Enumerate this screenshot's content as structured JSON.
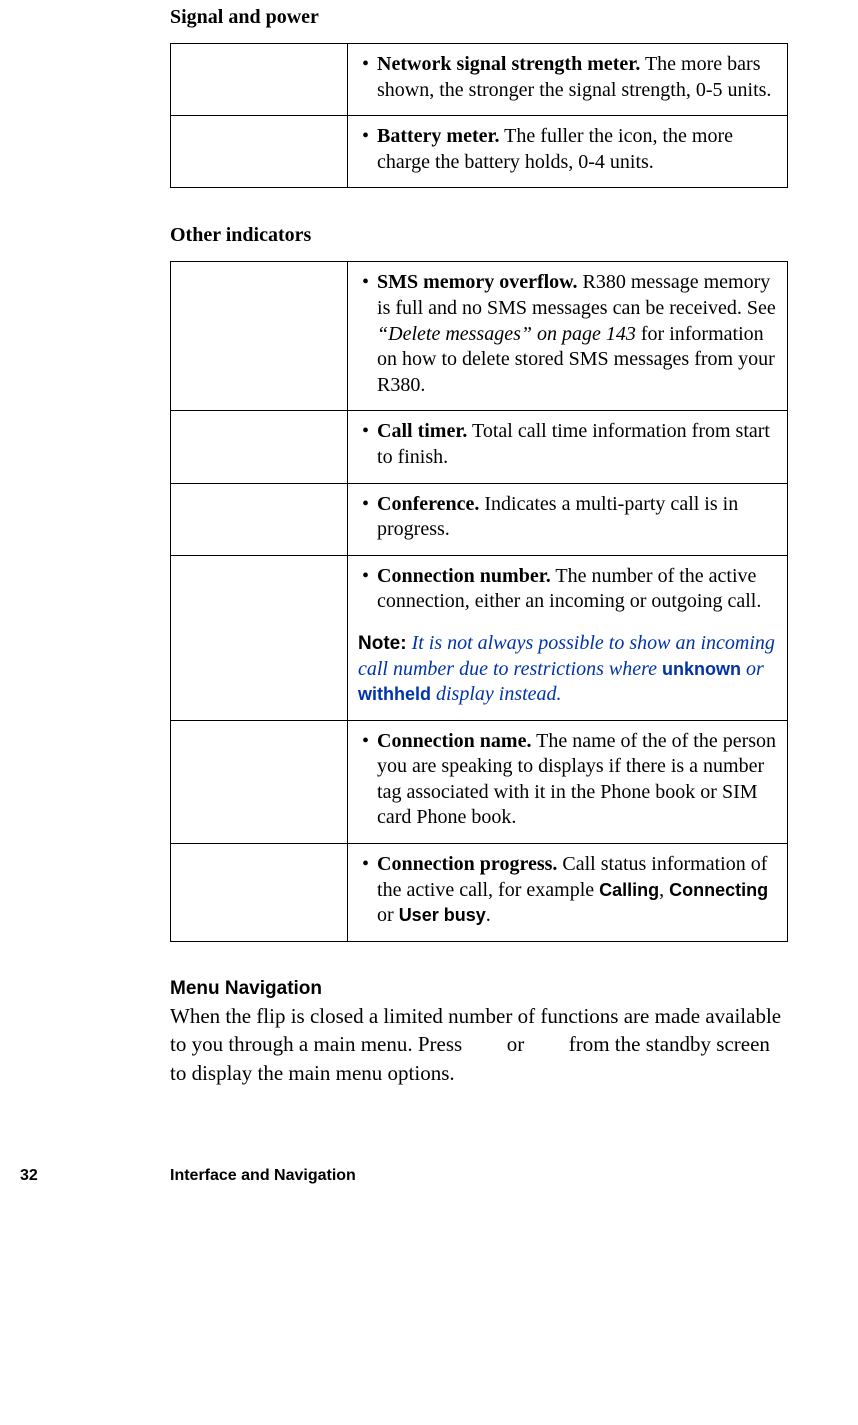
{
  "heading1": "Signal and power",
  "table1": [
    {
      "bold": "Network signal strength meter.",
      "rest": " The more bars shown, the stronger the signal strength, 0-5 units."
    },
    {
      "bold": "Battery meter.",
      "rest": " The fuller the icon, the more charge the battery holds, 0-4 units."
    }
  ],
  "heading2": "Other indicators",
  "table2": {
    "row1": {
      "bold": "SMS memory overflow.",
      "text1": " R380 message memory is full and no SMS messages can be received. See ",
      "ital": "“Delete messages” on page 143",
      "text2": " for information on how to delete stored SMS messages from your R380."
    },
    "row2": {
      "bold": "Call timer.",
      "rest": " Total call time information from start to finish."
    },
    "row3": {
      "bold": "Conference.",
      "rest": " Indicates a multi-party call is in progress."
    },
    "row4": {
      "bold": "Connection number.",
      "rest": " The number of the active connection, either an incoming or outgoing call.",
      "note_label": "Note:",
      "note_pre": "  It is not always possible to show an incoming call number due to restrictions where ",
      "kw1": "unknown",
      "note_mid": " or ",
      "kw2": "withheld",
      "note_post": " display instead."
    },
    "row5": {
      "bold": "Connection name.",
      "rest": " The name of the of the person you are speaking to displays if there is a number tag associated with it in the Phone book or SIM card Phone book."
    },
    "row6": {
      "bold": "Connection progress.",
      "text1": " Call status information of the active call, for example ",
      "kw1": "Calling",
      "sep1": ", ",
      "kw2": "Connecting",
      "sep2": " or ",
      "kw3": "User busy",
      "dot": "."
    }
  },
  "menu_heading": "Menu Navigation",
  "menu_para": {
    "p1": "When the flip is closed a limited number of functions are made available to you through a main menu. Press ",
    "p2": " or ",
    "p3": " from the standby screen to display the main menu options."
  },
  "footer": {
    "page": "32",
    "section": "Interface and Navigation"
  }
}
